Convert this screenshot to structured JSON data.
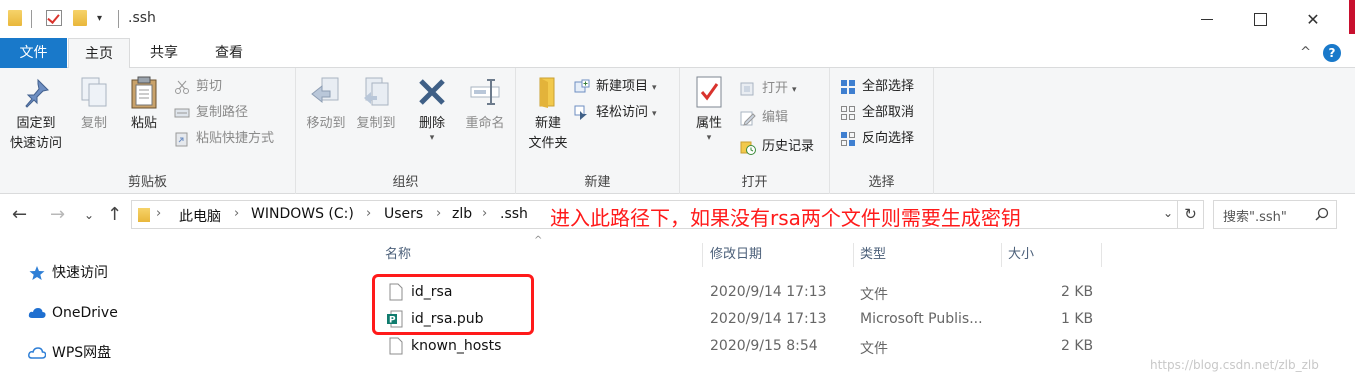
{
  "titlebar": {
    "title": ".ssh",
    "qa_dropdown": "▾",
    "minimize_label": "",
    "maximize_label": "",
    "close_label": "✕"
  },
  "tabs": [
    {
      "label": "文件"
    },
    {
      "label": "主页"
    },
    {
      "label": "共享"
    },
    {
      "label": "查看"
    }
  ],
  "ribbon": {
    "clipboard": {
      "group_label": "剪贴板",
      "pin_line1": "固定到",
      "pin_line2": "快速访问",
      "copy": "复制",
      "paste": "粘贴",
      "cut": "剪切",
      "copy_path": "复制路径",
      "paste_shortcut": "粘贴快捷方式"
    },
    "organize": {
      "group_label": "组织",
      "move_to": "移动到",
      "copy_to": "复制到",
      "delete": "删除",
      "rename": "重命名"
    },
    "new": {
      "group_label": "新建",
      "new_folder_line1": "新建",
      "new_folder_line2": "文件夹",
      "new_item": "新建项目",
      "easy_access": "轻松访问"
    },
    "open": {
      "group_label": "打开",
      "properties": "属性",
      "open": "打开",
      "edit": "编辑",
      "history": "历史记录"
    },
    "select": {
      "group_label": "选择",
      "select_all": "全部选择",
      "select_none": "全部取消",
      "invert": "反向选择"
    }
  },
  "address": {
    "crumbs": [
      "此电脑",
      "WINDOWS (C:)",
      "Users",
      "zlb",
      ".ssh"
    ],
    "separator": "›",
    "annotation": "进入此路径下，如果没有rsa两个文件则需要生成密钥",
    "search_placeholder": "搜索\".ssh\""
  },
  "navpane": {
    "items": [
      {
        "label": "快速访问"
      },
      {
        "label": "OneDrive"
      },
      {
        "label": "WPS网盘"
      }
    ]
  },
  "filelist": {
    "columns": [
      "名称",
      "修改日期",
      "类型",
      "大小"
    ],
    "rows": [
      {
        "name": "id_rsa",
        "date": "2020/9/14 17:13",
        "type": "文件",
        "size": "2 KB"
      },
      {
        "name": "id_rsa.pub",
        "date": "2020/9/14 17:13",
        "type": "Microsoft Publis...",
        "size": "1 KB"
      },
      {
        "name": "known_hosts",
        "date": "2020/9/15 8:54",
        "type": "文件",
        "size": "2 KB"
      }
    ]
  },
  "watermark": "https://blog.csdn.net/zlb_zlb",
  "colors": {
    "accent": "#1979ca",
    "annotation": "#ff1a1a",
    "ribbon_bg": "#f5f6f7"
  }
}
